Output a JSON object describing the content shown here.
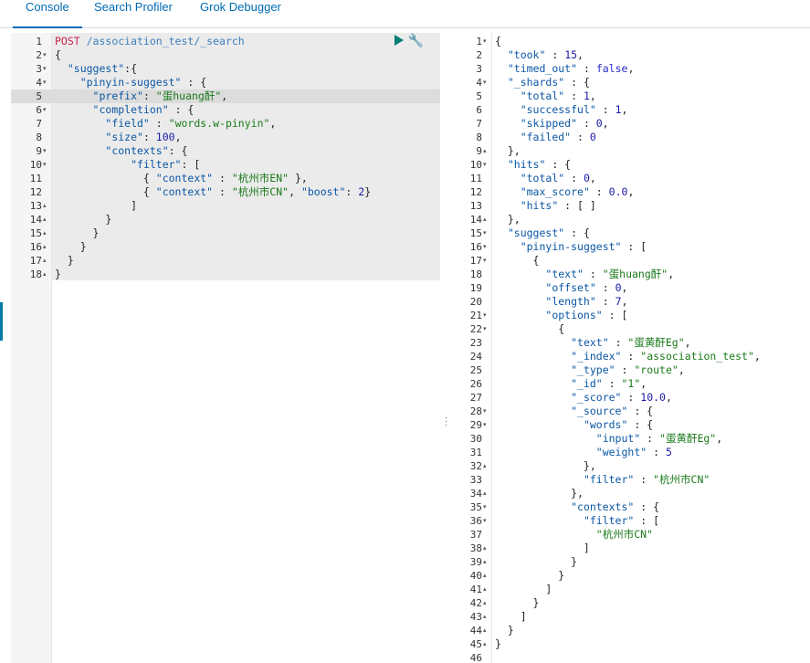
{
  "tabs": [
    {
      "label": "Console",
      "active": true
    },
    {
      "label": "Search Profiler",
      "active": false
    },
    {
      "label": "Grok Debugger",
      "active": false
    }
  ],
  "request": {
    "lines": [
      [
        [
          "meth",
          "POST "
        ],
        [
          "url",
          "/association_test/_search"
        ]
      ],
      [
        [
          "pun",
          "{"
        ]
      ],
      [
        [
          "pun",
          "  "
        ],
        [
          "key",
          "\"suggest\""
        ],
        [
          "pun",
          ":{"
        ]
      ],
      [
        [
          "pun",
          "    "
        ],
        [
          "key",
          "\"pinyin-suggest\""
        ],
        [
          "pun",
          " : {"
        ]
      ],
      [
        [
          "pun",
          "      "
        ],
        [
          "key",
          "\"prefix\""
        ],
        [
          "pun",
          ": "
        ],
        [
          "str",
          "\"蛋huang酐\""
        ],
        [
          "pun",
          ","
        ]
      ],
      [
        [
          "pun",
          "      "
        ],
        [
          "key",
          "\"completion\""
        ],
        [
          "pun",
          " : {"
        ]
      ],
      [
        [
          "pun",
          "        "
        ],
        [
          "key",
          "\"field\""
        ],
        [
          "pun",
          " : "
        ],
        [
          "str",
          "\"words.w-pinyin\""
        ],
        [
          "pun",
          ","
        ]
      ],
      [
        [
          "pun",
          "        "
        ],
        [
          "key",
          "\"size\""
        ],
        [
          "pun",
          ": "
        ],
        [
          "num",
          "100"
        ],
        [
          "pun",
          ","
        ]
      ],
      [
        [
          "pun",
          "        "
        ],
        [
          "key",
          "\"contexts\""
        ],
        [
          "pun",
          ": {"
        ]
      ],
      [
        [
          "pun",
          "            "
        ],
        [
          "key",
          "\"filter\""
        ],
        [
          "pun",
          ": ["
        ]
      ],
      [
        [
          "pun",
          "              { "
        ],
        [
          "key",
          "\"context\""
        ],
        [
          "pun",
          " : "
        ],
        [
          "str",
          "\"杭州市EN\""
        ],
        [
          "pun",
          " },"
        ]
      ],
      [
        [
          "pun",
          "              { "
        ],
        [
          "key",
          "\"context\""
        ],
        [
          "pun",
          " : "
        ],
        [
          "str",
          "\"杭州市CN\""
        ],
        [
          "pun",
          ", "
        ],
        [
          "key",
          "\"boost\""
        ],
        [
          "pun",
          ": "
        ],
        [
          "num",
          "2"
        ],
        [
          "pun",
          "}"
        ]
      ],
      [
        [
          "pun",
          "            ]"
        ]
      ],
      [
        [
          "pun",
          "        }"
        ]
      ],
      [
        [
          "pun",
          "      }"
        ]
      ],
      [
        [
          "pun",
          "    }"
        ]
      ],
      [
        [
          "pun",
          "  }"
        ]
      ],
      [
        [
          "pun",
          "}"
        ]
      ]
    ],
    "folds": [
      "",
      "▾",
      "▾",
      "▾",
      "",
      "▾",
      "",
      "",
      "▾",
      "▾",
      "",
      "",
      "▴",
      "▴",
      "▴",
      "▴",
      "▴",
      "▴"
    ]
  },
  "response": {
    "lines": [
      [
        [
          "pun",
          "{"
        ]
      ],
      [
        [
          "pun",
          "  "
        ],
        [
          "key",
          "\"took\""
        ],
        [
          "pun",
          " : "
        ],
        [
          "num",
          "15"
        ],
        [
          "pun",
          ","
        ]
      ],
      [
        [
          "pun",
          "  "
        ],
        [
          "key",
          "\"timed_out\""
        ],
        [
          "pun",
          " : "
        ],
        [
          "kw",
          "false"
        ],
        [
          "pun",
          ","
        ]
      ],
      [
        [
          "pun",
          "  "
        ],
        [
          "key",
          "\"_shards\""
        ],
        [
          "pun",
          " : {"
        ]
      ],
      [
        [
          "pun",
          "    "
        ],
        [
          "key",
          "\"total\""
        ],
        [
          "pun",
          " : "
        ],
        [
          "num",
          "1"
        ],
        [
          "pun",
          ","
        ]
      ],
      [
        [
          "pun",
          "    "
        ],
        [
          "key",
          "\"successful\""
        ],
        [
          "pun",
          " : "
        ],
        [
          "num",
          "1"
        ],
        [
          "pun",
          ","
        ]
      ],
      [
        [
          "pun",
          "    "
        ],
        [
          "key",
          "\"skipped\""
        ],
        [
          "pun",
          " : "
        ],
        [
          "num",
          "0"
        ],
        [
          "pun",
          ","
        ]
      ],
      [
        [
          "pun",
          "    "
        ],
        [
          "key",
          "\"failed\""
        ],
        [
          "pun",
          " : "
        ],
        [
          "num",
          "0"
        ]
      ],
      [
        [
          "pun",
          "  },"
        ]
      ],
      [
        [
          "pun",
          "  "
        ],
        [
          "key",
          "\"hits\""
        ],
        [
          "pun",
          " : {"
        ]
      ],
      [
        [
          "pun",
          "    "
        ],
        [
          "key",
          "\"total\""
        ],
        [
          "pun",
          " : "
        ],
        [
          "num",
          "0"
        ],
        [
          "pun",
          ","
        ]
      ],
      [
        [
          "pun",
          "    "
        ],
        [
          "key",
          "\"max_score\""
        ],
        [
          "pun",
          " : "
        ],
        [
          "num",
          "0.0"
        ],
        [
          "pun",
          ","
        ]
      ],
      [
        [
          "pun",
          "    "
        ],
        [
          "key",
          "\"hits\""
        ],
        [
          "pun",
          " : [ ]"
        ]
      ],
      [
        [
          "pun",
          "  },"
        ]
      ],
      [
        [
          "pun",
          "  "
        ],
        [
          "key",
          "\"suggest\""
        ],
        [
          "pun",
          " : {"
        ]
      ],
      [
        [
          "pun",
          "    "
        ],
        [
          "key",
          "\"pinyin-suggest\""
        ],
        [
          "pun",
          " : ["
        ]
      ],
      [
        [
          "pun",
          "      {"
        ]
      ],
      [
        [
          "pun",
          "        "
        ],
        [
          "key",
          "\"text\""
        ],
        [
          "pun",
          " : "
        ],
        [
          "str",
          "\"蛋huang酐\""
        ],
        [
          "pun",
          ","
        ]
      ],
      [
        [
          "pun",
          "        "
        ],
        [
          "key",
          "\"offset\""
        ],
        [
          "pun",
          " : "
        ],
        [
          "num",
          "0"
        ],
        [
          "pun",
          ","
        ]
      ],
      [
        [
          "pun",
          "        "
        ],
        [
          "key",
          "\"length\""
        ],
        [
          "pun",
          " : "
        ],
        [
          "num",
          "7"
        ],
        [
          "pun",
          ","
        ]
      ],
      [
        [
          "pun",
          "        "
        ],
        [
          "key",
          "\"options\""
        ],
        [
          "pun",
          " : ["
        ]
      ],
      [
        [
          "pun",
          "          {"
        ]
      ],
      [
        [
          "pun",
          "            "
        ],
        [
          "key",
          "\"text\""
        ],
        [
          "pun",
          " : "
        ],
        [
          "str",
          "\"蛋黄酐Eg\""
        ],
        [
          "pun",
          ","
        ]
      ],
      [
        [
          "pun",
          "            "
        ],
        [
          "key",
          "\"_index\""
        ],
        [
          "pun",
          " : "
        ],
        [
          "str",
          "\"association_test\""
        ],
        [
          "pun",
          ","
        ]
      ],
      [
        [
          "pun",
          "            "
        ],
        [
          "key",
          "\"_type\""
        ],
        [
          "pun",
          " : "
        ],
        [
          "str",
          "\"route\""
        ],
        [
          "pun",
          ","
        ]
      ],
      [
        [
          "pun",
          "            "
        ],
        [
          "key",
          "\"_id\""
        ],
        [
          "pun",
          " : "
        ],
        [
          "str",
          "\"1\""
        ],
        [
          "pun",
          ","
        ]
      ],
      [
        [
          "pun",
          "            "
        ],
        [
          "key",
          "\"_score\""
        ],
        [
          "pun",
          " : "
        ],
        [
          "num",
          "10.0"
        ],
        [
          "pun",
          ","
        ]
      ],
      [
        [
          "pun",
          "            "
        ],
        [
          "key",
          "\"_source\""
        ],
        [
          "pun",
          " : {"
        ]
      ],
      [
        [
          "pun",
          "              "
        ],
        [
          "key",
          "\"words\""
        ],
        [
          "pun",
          " : {"
        ]
      ],
      [
        [
          "pun",
          "                "
        ],
        [
          "key",
          "\"input\""
        ],
        [
          "pun",
          " : "
        ],
        [
          "str",
          "\"蛋黄酐Eg\""
        ],
        [
          "pun",
          ","
        ]
      ],
      [
        [
          "pun",
          "                "
        ],
        [
          "key",
          "\"weight\""
        ],
        [
          "pun",
          " : "
        ],
        [
          "num",
          "5"
        ]
      ],
      [
        [
          "pun",
          "              },"
        ]
      ],
      [
        [
          "pun",
          "              "
        ],
        [
          "key",
          "\"filter\""
        ],
        [
          "pun",
          " : "
        ],
        [
          "str",
          "\"杭州市CN\""
        ]
      ],
      [
        [
          "pun",
          "            },"
        ]
      ],
      [
        [
          "pun",
          "            "
        ],
        [
          "key",
          "\"contexts\""
        ],
        [
          "pun",
          " : {"
        ]
      ],
      [
        [
          "pun",
          "              "
        ],
        [
          "key",
          "\"filter\""
        ],
        [
          "pun",
          " : ["
        ]
      ],
      [
        [
          "pun",
          "                "
        ],
        [
          "str",
          "\"杭州市CN\""
        ]
      ],
      [
        [
          "pun",
          "              ]"
        ]
      ],
      [
        [
          "pun",
          "            }"
        ]
      ],
      [
        [
          "pun",
          "          }"
        ]
      ],
      [
        [
          "pun",
          "        ]"
        ]
      ],
      [
        [
          "pun",
          "      }"
        ]
      ],
      [
        [
          "pun",
          "    ]"
        ]
      ],
      [
        [
          "pun",
          "  }"
        ]
      ],
      [
        [
          "pun",
          "}"
        ]
      ],
      [
        [
          "pun",
          ""
        ]
      ]
    ],
    "folds": [
      "▾",
      "",
      "",
      "▾",
      "",
      "",
      "",
      "",
      "▴",
      "▾",
      "",
      "",
      "",
      "▴",
      "▾",
      "▾",
      "▾",
      "",
      "",
      "",
      "▾",
      "▾",
      "",
      "",
      "",
      "",
      "",
      "▾",
      "▾",
      "",
      "",
      "▴",
      "",
      "▴",
      "▾",
      "▾",
      "",
      "▴",
      "▴",
      "▴",
      "▴",
      "▴",
      "▴",
      "▴",
      "▴",
      ""
    ]
  },
  "icons": {
    "run": "play-icon",
    "settings": "wrench-icon",
    "resize": "drag-handle-icon"
  }
}
